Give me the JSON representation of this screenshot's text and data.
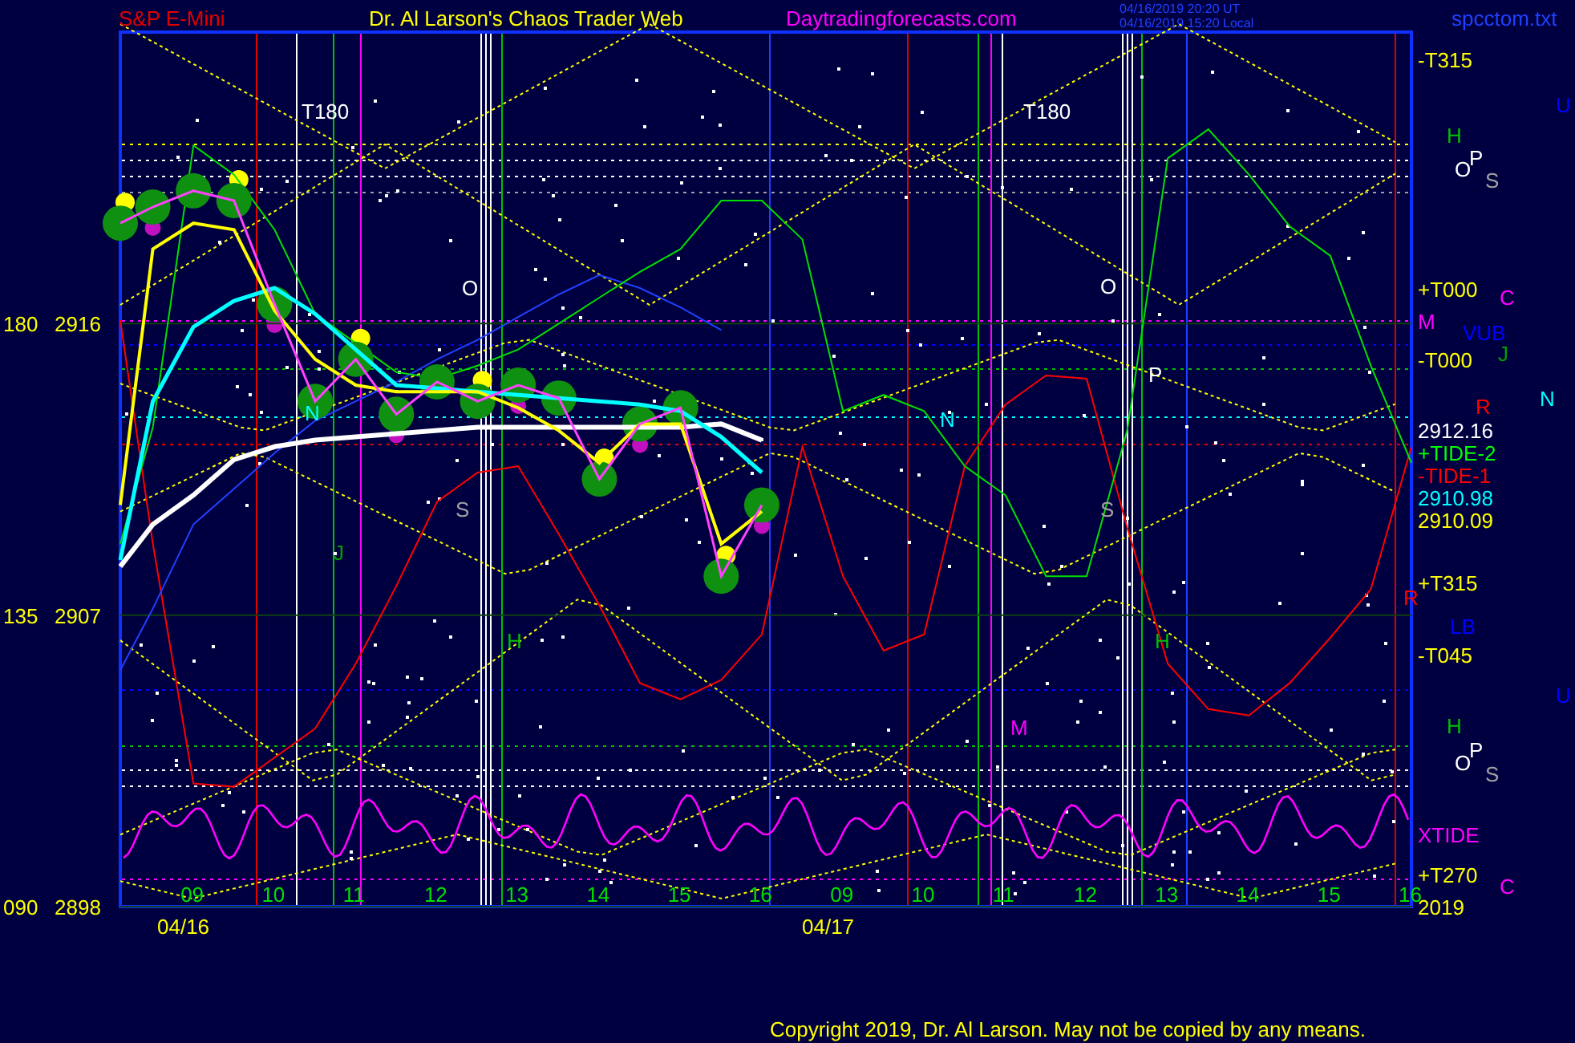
{
  "header": {
    "symbol": "S&P E-Mini",
    "title": "Dr. Al Larson's Chaos Trader Web",
    "site": "Daytradingforecasts.com",
    "time_utc": "04/16/2019 20:20  UT",
    "time_local": "04/16/2019 15:20 Local",
    "file": "spcctom.txt"
  },
  "angle_labels": [
    "180",
    "135",
    "090"
  ],
  "dates": [
    "04/16",
    "04/17"
  ],
  "next_day_hours": [
    "09",
    "10",
    "11",
    "12",
    "13",
    "14",
    "15",
    "16"
  ],
  "chart_data": {
    "type": "line",
    "x": [
      8.1,
      8.5,
      9,
      9.5,
      10,
      10.5,
      11,
      11.5,
      12,
      12.5,
      13,
      13.5,
      14,
      14.5,
      15,
      15.5,
      16,
      16.5,
      17,
      17.5,
      18,
      18.5,
      19,
      19.5,
      20,
      20.5,
      21,
      21.5,
      22,
      22.5,
      23,
      23.5,
      24
    ],
    "xlim": [
      8.1,
      24
    ],
    "ylim": [
      2898,
      2925
    ],
    "xticks": [
      {
        "value": 9,
        "label": "09"
      },
      {
        "value": 10,
        "label": "10"
      },
      {
        "value": 11,
        "label": "11"
      },
      {
        "value": 12,
        "label": "12"
      },
      {
        "value": 13,
        "label": "13"
      },
      {
        "value": 14,
        "label": "14"
      },
      {
        "value": 15,
        "label": "15"
      },
      {
        "value": 16,
        "label": "16"
      }
    ],
    "yticks": [
      {
        "value": 2916,
        "label": "2916"
      },
      {
        "value": 2907,
        "label": "2907"
      },
      {
        "value": 2898,
        "label": "2898"
      }
    ],
    "series": [
      {
        "color": "#ff0000",
        "values": [
          2916.1,
          2909.2,
          2901.8,
          2901.7,
          2902.6,
          2903.5,
          2905.5,
          2907.9,
          2910.5,
          2911.4,
          2911.6,
          2909.5,
          2907.3,
          2904.9,
          2904.4,
          2905.0,
          2906.4,
          2912.2,
          2908.2,
          2905.9,
          2906.4,
          2911.6,
          2913.5,
          2914.4,
          2914.3,
          2909.7,
          2905.5,
          2904.1,
          2903.9,
          2904.9,
          2906.3,
          2907.8,
          2912.2
        ]
      },
      {
        "color": "#2040ff",
        "values": [
          2905.3,
          2907.2,
          2909.8,
          2910.9,
          2912.0,
          2913.0,
          2913.6,
          2914.2,
          2914.9,
          2915.5,
          2916.2,
          2916.9,
          2917.5,
          2917.1,
          2916.5,
          2915.8,
          null,
          null,
          null,
          null,
          null,
          null,
          null,
          null,
          null,
          null,
          null,
          null,
          null,
          null,
          null,
          null,
          null
        ]
      },
      {
        "color": "#00e000",
        "values": [
          2909.2,
          2912.8,
          2921.5,
          2920.6,
          2918.9,
          2916.3,
          2915.4,
          2914.5,
          2914.3,
          2914.7,
          2915.2,
          2916.0,
          2916.8,
          2917.6,
          2918.3,
          2919.8,
          2919.8,
          2918.6,
          2913.3,
          2913.8,
          2913.3,
          2911.6,
          2910.7,
          2908.2,
          2908.2,
          2912.7,
          2921.1,
          2922.0,
          2920.6,
          2919.0,
          2918.1,
          2914.7,
          2911.7
        ]
      },
      {
        "color": "#ffffff",
        "values": [
          2908.5,
          2909.8,
          2910.7,
          2911.8,
          2912.2,
          2912.4,
          2912.5,
          2912.6,
          2912.7,
          2912.8,
          2912.8,
          2912.8,
          2912.8,
          2912.8,
          2912.8,
          2912.9,
          2912.4,
          null,
          null,
          null,
          null,
          null,
          null,
          null,
          null,
          null,
          null,
          null,
          null,
          null,
          null,
          null,
          null
        ]
      },
      {
        "color": "#00ffff",
        "values": [
          2908.7,
          2913.6,
          2915.9,
          2916.7,
          2917.1,
          2916.3,
          2915.2,
          2914.1,
          2914.0,
          2913.9,
          2913.8,
          2913.7,
          2913.6,
          2913.5,
          2913.3,
          2912.5,
          2911.4,
          null,
          null,
          null,
          null,
          null,
          null,
          null,
          null,
          null,
          null,
          null,
          null,
          null,
          null,
          null,
          null
        ]
      },
      {
        "color": "#ffff00",
        "values": [
          2910.4,
          2918.3,
          2919.1,
          2918.9,
          2916.4,
          2914.9,
          2914.1,
          2913.9,
          2913.9,
          2913.9,
          2913.4,
          2912.7,
          2911.7,
          2912.9,
          2912.9,
          2909.2,
          2910.2,
          null,
          null,
          null,
          null,
          null,
          null,
          null,
          null,
          null,
          null,
          null,
          null,
          null,
          null,
          null,
          null
        ]
      },
      {
        "color": "#ff40ff",
        "marker": "circle",
        "values": [
          2919.1,
          2919.6,
          2920.1,
          2919.8,
          2916.6,
          2913.6,
          2914.9,
          2913.2,
          2914.2,
          2913.6,
          2914.1,
          2913.7,
          2911.2,
          2912.9,
          2913.4,
          2908.2,
          2910.4,
          null,
          null,
          null,
          null,
          null,
          null,
          null,
          null,
          null,
          null,
          null,
          null,
          null,
          null,
          null,
          null
        ]
      }
    ]
  },
  "right_labels": [
    {
      "text": "-T315",
      "color": "#ffff00"
    },
    {
      "text": "+T000",
      "color": "#ffff00"
    },
    {
      "text": "M",
      "color": "#ff00ff"
    },
    {
      "text": "-T000",
      "color": "#ffff00"
    },
    {
      "text": "2912.16",
      "color": "#ffffff"
    },
    {
      "text": "+TIDE-2",
      "color": "#00ff00"
    },
    {
      "text": "-TIDE-1",
      "color": "#ff0000"
    },
    {
      "text": "2910.98",
      "color": "#00ffff"
    },
    {
      "text": "2910.09",
      "color": "#ffff00"
    },
    {
      "text": "+T315",
      "color": "#ffff00"
    },
    {
      "text": "-T045",
      "color": "#ffff00"
    },
    {
      "text": "XTIDE",
      "color": "#ff00ff"
    },
    {
      "text": "+T270",
      "color": "#ffff00"
    },
    {
      "text": "2019",
      "color": "#ffff00"
    }
  ],
  "planet_labels": [
    {
      "text": "U",
      "color": "#0000ff"
    },
    {
      "text": "H",
      "color": "#00c000"
    },
    {
      "text": "O",
      "color": "#ffffff"
    },
    {
      "text": "P",
      "color": "#ffffff"
    },
    {
      "text": "S",
      "color": "#a0a0a0"
    },
    {
      "text": "C",
      "color": "#ff00ff"
    },
    {
      "text": "VUB",
      "color": "#0000ff"
    },
    {
      "text": "J",
      "color": "#00a000"
    },
    {
      "text": "N",
      "color": "#00ffff"
    },
    {
      "text": "R",
      "color": "#ff0000"
    },
    {
      "text": "R",
      "color": "#ff0000"
    },
    {
      "text": "LB",
      "color": "#0000ff"
    },
    {
      "text": "U",
      "color": "#0000ff"
    },
    {
      "text": "H",
      "color": "#00c000"
    },
    {
      "text": "O",
      "color": "#ffffff"
    },
    {
      "text": "P",
      "color": "#ffffff"
    },
    {
      "text": "S",
      "color": "#a0a0a0"
    },
    {
      "text": "C",
      "color": "#ff00ff"
    }
  ],
  "chart_labels": [
    {
      "text": "T180",
      "color": "#ffffff"
    },
    {
      "text": "T180",
      "color": "#ffffff"
    },
    {
      "text": "O",
      "color": "#ffffff"
    },
    {
      "text": "N",
      "color": "#00ffff"
    },
    {
      "text": "J",
      "color": "#00a000"
    },
    {
      "text": "S",
      "color": "#a0a0a0"
    },
    {
      "text": "H",
      "color": "#00c000"
    },
    {
      "text": "O",
      "color": "#ffffff"
    },
    {
      "text": "P",
      "color": "#ffffff"
    },
    {
      "text": "N",
      "color": "#00ffff"
    },
    {
      "text": "S",
      "color": "#a0a0a0"
    },
    {
      "text": "M",
      "color": "#ff00ff"
    },
    {
      "text": "H",
      "color": "#00c000"
    }
  ],
  "copyright": "Copyright 2019, Dr. Al Larson. May not be copied by any means."
}
